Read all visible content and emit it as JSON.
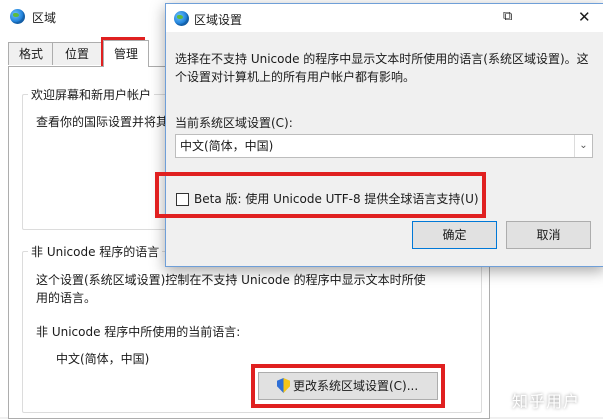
{
  "background_window": {
    "title": "区域",
    "tabs": [
      {
        "label": "格式"
      },
      {
        "label": "位置"
      },
      {
        "label": "管理"
      }
    ],
    "welcome_group": {
      "legend": "欢迎屏幕和新用户帐户",
      "text": "查看你的国际设置并将其"
    },
    "unicode_group": {
      "legend": "非 Unicode 程序的语言",
      "description_line1": "这个设置(系统区域设置)控制在不支持 Unicode 的程序中显示文本时所使",
      "description_line2": "用的语言。",
      "current_label": "非 Unicode 程序中所使用的当前语言:",
      "current_value": "中文(简体，中国)",
      "change_button": "更改系统区域设置(C)..."
    }
  },
  "dialog": {
    "title": "区域设置",
    "description_line1": "选择在不支持 Unicode 的程序中显示文本时所使用的语言(系统区域设置)。这",
    "description_line2": "个设置对计算机上的所有用户帐户都有影响。",
    "current_label": "当前系统区域设置(C):",
    "locale_value": "中文(简体，中国)",
    "beta_label": "Beta 版: 使用 Unicode UTF-8 提供全球语言支持(U)",
    "beta_checked": false,
    "ok_button": "确定",
    "cancel_button": "取消",
    "close_symbol": "✕",
    "snap_symbol": "⧉"
  },
  "watermark": "知乎用户",
  "colors": {
    "highlight_red": "#e02020",
    "dialog_border": "#6f9fd8",
    "ok_border": "#0078d7"
  }
}
